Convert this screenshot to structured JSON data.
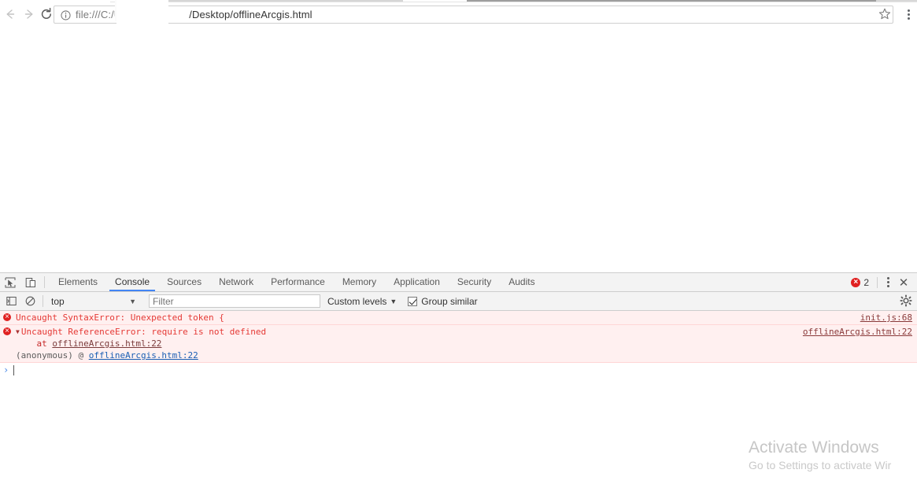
{
  "browser": {
    "nav": {
      "back_label": "Back",
      "forward_label": "Forward",
      "reload_label": "Reload"
    },
    "omnibox": {
      "info_icon": "info-circle-icon",
      "url_prefix": "file:///C:/U",
      "url_suffix": "/Desktop/offlineArcgis.html",
      "full_url": "file:///C:/U.../Desktop/offlineArcgis.html"
    },
    "star_label": "Bookmark this page",
    "menu_label": "Customize and control Google Chrome"
  },
  "devtools": {
    "inspect_icon": "inspect-element-icon",
    "device_icon": "device-toolbar-icon",
    "tabs": [
      {
        "label": "Elements",
        "active": false
      },
      {
        "label": "Console",
        "active": true
      },
      {
        "label": "Sources",
        "active": false
      },
      {
        "label": "Network",
        "active": false
      },
      {
        "label": "Performance",
        "active": false
      },
      {
        "label": "Memory",
        "active": false
      },
      {
        "label": "Application",
        "active": false
      },
      {
        "label": "Security",
        "active": false
      },
      {
        "label": "Audits",
        "active": false
      }
    ],
    "error_count": "2",
    "more_label": "More options",
    "close_label": "✕",
    "console_toolbar": {
      "sidebar_icon": "console-sidebar-icon",
      "clear_icon": "clear-console-icon",
      "context_value": "top",
      "context_caret": "▼",
      "filter_placeholder": "Filter",
      "filter_value": "",
      "levels_label": "Custom levels",
      "levels_caret": "▼",
      "group_similar_label": "Group similar",
      "group_similar_checked": true,
      "settings_icon": "gear-icon"
    },
    "messages": [
      {
        "text": "Uncaught SyntaxError: Unexpected token {",
        "source": "init.js:68",
        "expandable": false
      },
      {
        "text": "Uncaught ReferenceError: require is not defined",
        "source": "offlineArcgis.html:22",
        "expandable": true,
        "expander": "▼",
        "stack": [
          {
            "prefix": "    at ",
            "link": "offlineArcgis.html:22",
            "style": "red"
          },
          {
            "prefix": "(anonymous) @ ",
            "link": "offlineArcgis.html:22",
            "style": "blue"
          }
        ]
      }
    ],
    "prompt": {
      "chevron": "›",
      "value": ""
    }
  },
  "watermark": {
    "title": "Activate Windows",
    "subtitle": "Go to Settings to activate Wir"
  },
  "colors": {
    "accent": "#4285f4",
    "error": "#e02020",
    "error_bg": "#fff0f0",
    "link": "#1a5fb4",
    "toolbar_bg": "#f3f3f3"
  }
}
